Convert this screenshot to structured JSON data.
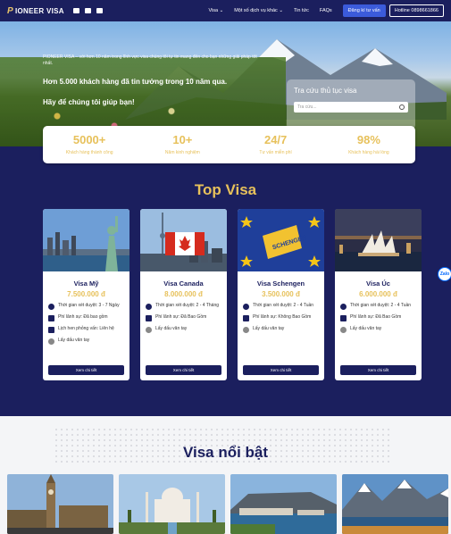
{
  "nav": {
    "logo_mark": "P",
    "logo_text": "IONEER VISA",
    "menu": [
      {
        "label": "Visa ⌄"
      },
      {
        "label": "Một số dịch vụ khác ⌄"
      },
      {
        "label": "Tin tức"
      },
      {
        "label": "FAQs"
      }
    ],
    "register_label": "Đăng kí tư vấn",
    "hotline_label": "Hotline 0898661866"
  },
  "hero": {
    "intro": "PIONEER VISA – với hơn 10 năm trong lĩnh vực visa chúng tôi tự tin mang đến cho bạn những giải pháp tốt nhất.",
    "line1": "Hơn 5.000 khách hàng đã tin tưởng trong 10 năm qua.",
    "line2": "Hãy để chúng tôi giúp bạn!",
    "lookup_title": "Tra cứu thủ tục visa",
    "search_placeholder": "Tra cứu..."
  },
  "stats": [
    {
      "value": "5000+",
      "label": "Khách hàng thành công"
    },
    {
      "value": "10+",
      "label": "Năm kinh nghiệm"
    },
    {
      "value": "24/7",
      "label": "Tư vấn miễn phí"
    },
    {
      "value": "98%",
      "label": "Khách hàng hài lòng"
    }
  ],
  "top_visa": {
    "title": "Top Visa",
    "cards": [
      {
        "name": "Visa Mỹ",
        "price": "7.500.000 đ",
        "features": [
          "Thời gian xét duyệt: 3 - 7 Ngày",
          "Phí lãnh sự: Đã bao gồm",
          "Lịch hen phỏng vấn: Liên hệ",
          "Lấy dấu vân tay"
        ],
        "button": "Xem chi tiết"
      },
      {
        "name": "Visa Canada",
        "price": "8.000.000 đ",
        "features": [
          "Thời gian xét duyệt: 2 - 4 Tháng",
          "Phí lãnh sự: Đã Bao Gồm",
          "Lấy dấu vân tay"
        ],
        "button": "Xem chi tiết"
      },
      {
        "name": "Visa Schengen",
        "price": "3.500.000 đ",
        "features": [
          "Thời gian xét duyệt: 2 - 4 Tuần",
          "Phí lãnh sự: Không Bao Gồm",
          "Lấy dấu vân tay"
        ],
        "button": "Xem chi tiết",
        "image_text": "SCHENGEN"
      },
      {
        "name": "Visa Úc",
        "price": "6.000.000 đ",
        "features": [
          "Thời gian xét duyệt: 2 - 4 Tuần",
          "Phí lãnh sự: Đã Bao Gồm",
          "Lấy dấu vân tay"
        ],
        "button": "Xem chi tiết"
      }
    ]
  },
  "zalo_label": "Zalo",
  "featured": {
    "title": "Visa nổi bật"
  },
  "colors": {
    "navy": "#1b1f5e",
    "gold": "#e7c15b",
    "blue_button": "#3b5bdb"
  }
}
